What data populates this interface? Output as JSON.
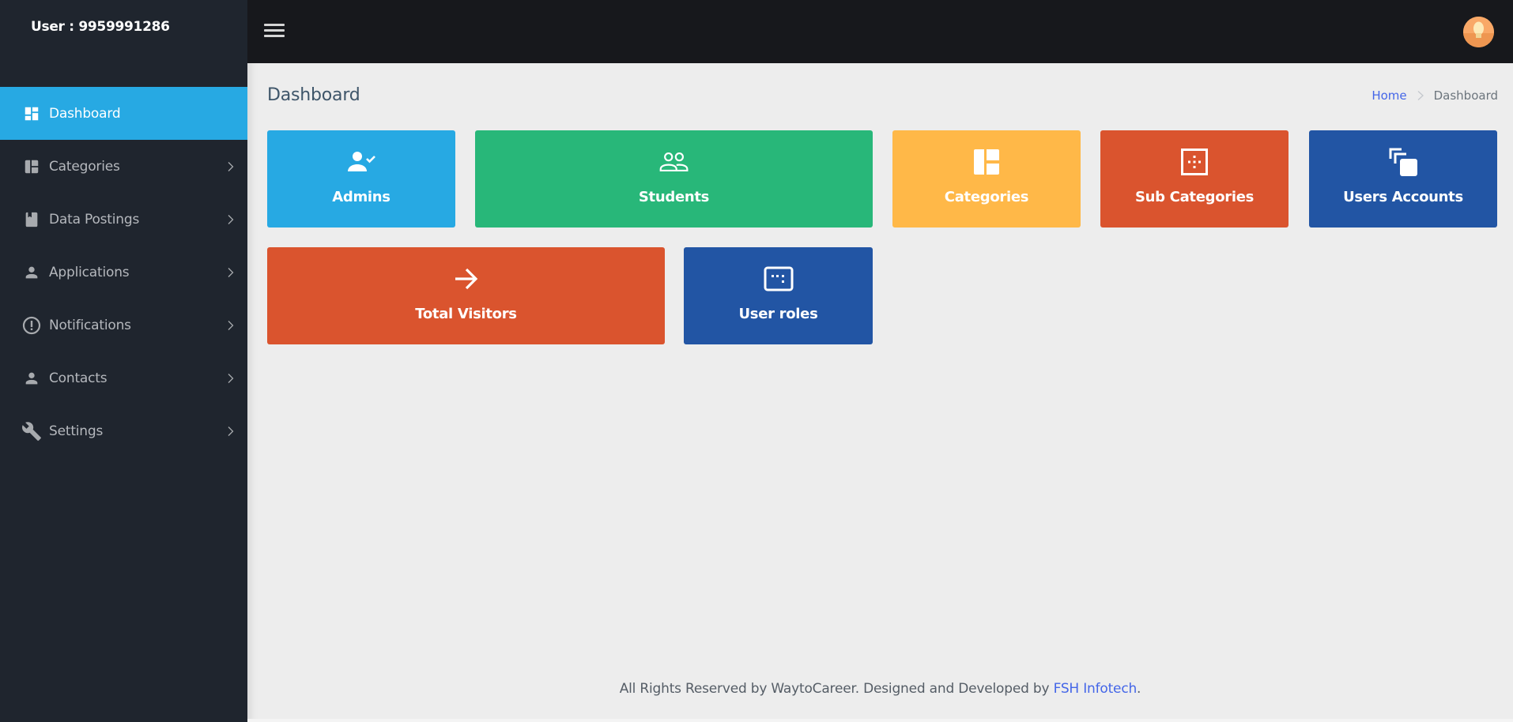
{
  "sidebar": {
    "user_label": "User : 9959991286",
    "items": [
      {
        "label": "Dashboard",
        "icon": "dashboard-icon",
        "active": true,
        "has_chevron": false
      },
      {
        "label": "Categories",
        "icon": "layout-icon",
        "active": false,
        "has_chevron": true
      },
      {
        "label": "Data Postings",
        "icon": "bookmark-book-icon",
        "active": false,
        "has_chevron": true
      },
      {
        "label": "Applications",
        "icon": "user-icon",
        "active": false,
        "has_chevron": true
      },
      {
        "label": "Notifications",
        "icon": "alert-circle-icon",
        "active": false,
        "has_chevron": true
      },
      {
        "label": "Contacts",
        "icon": "user-icon",
        "active": false,
        "has_chevron": true
      },
      {
        "label": "Settings",
        "icon": "wrench-icon",
        "active": false,
        "has_chevron": true
      }
    ]
  },
  "topbar": {
    "menu_icon": "hamburger-icon",
    "avatar_icon": "user-avatar"
  },
  "page": {
    "title": "Dashboard",
    "breadcrumb": {
      "home": "Home",
      "separator": ">",
      "current": "Dashboard"
    }
  },
  "cards": [
    {
      "title": "Admins",
      "icon": "account-check-icon",
      "color": "#27a9e3"
    },
    {
      "title": "Students",
      "icon": "account-multiple-outline-icon",
      "color": "#28b779"
    },
    {
      "title": "Categories",
      "icon": "layout-icon",
      "color": "#ffb848"
    },
    {
      "title": "Sub Categories",
      "icon": "border-inside-icon",
      "color": "#da542e"
    },
    {
      "title": "Users Accounts",
      "icon": "copy-stack-icon",
      "color": "#2255a4"
    },
    {
      "title": "Total Visitors",
      "icon": "arrow-right-icon",
      "color": "#da542e"
    },
    {
      "title": "User roles",
      "icon": "keyboard-dots-icon",
      "color": "#2255a4"
    }
  ],
  "footer": {
    "text": "All Rights Reserved by WaytoCareer. Designed and Developed by ",
    "link": "FSH Infotech",
    "end": "."
  },
  "colors": {
    "sidebar_bg": "#1f252e",
    "topbar_bg": "#17181c",
    "active_item": "#27a9e3",
    "content_bg": "#ededed",
    "link": "#4466e8"
  }
}
